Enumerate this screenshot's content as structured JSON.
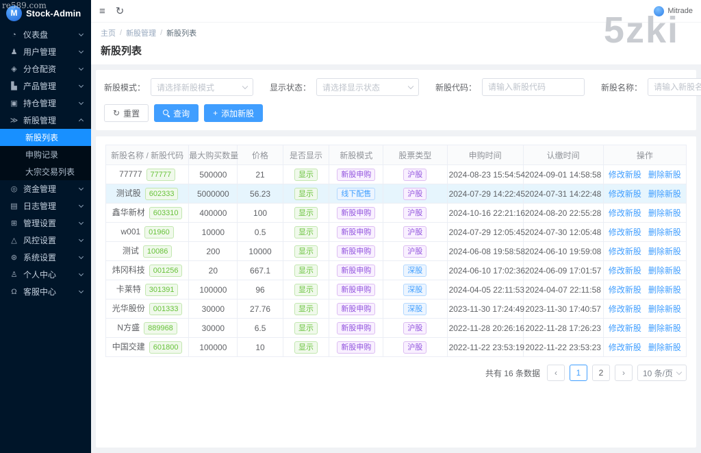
{
  "watermarks": {
    "top_left": "re589.com",
    "top_right": "5zki"
  },
  "sidebar": {
    "logo_text": "Stock-Admin",
    "logo_glyph": "M",
    "items": [
      {
        "key": "dashboard",
        "icon": "gauge-icon",
        "label": "仪表盘"
      },
      {
        "key": "users",
        "icon": "users-icon",
        "label": "用户管理"
      },
      {
        "key": "allocation",
        "icon": "allocation-icon",
        "label": "分仓配资"
      },
      {
        "key": "product",
        "icon": "product-icon",
        "label": "产品管理"
      },
      {
        "key": "holdings",
        "icon": "holdings-icon",
        "label": "持仓管理"
      },
      {
        "key": "new-stock",
        "icon": "new-stock-icon",
        "label": "新股管理",
        "expanded": true,
        "children": [
          {
            "key": "new-stock-list",
            "label": "新股列表",
            "active": true
          },
          {
            "key": "subscription-records",
            "label": "申购记录"
          },
          {
            "key": "block-trade-list",
            "label": "大宗交易列表"
          }
        ]
      },
      {
        "key": "funds",
        "icon": "funds-icon",
        "label": "资金管理"
      },
      {
        "key": "logs",
        "icon": "logs-icon",
        "label": "日志管理"
      },
      {
        "key": "admin-settings",
        "icon": "admin-settings-icon",
        "label": "管理设置"
      },
      {
        "key": "risk-settings",
        "icon": "risk-icon",
        "label": "风控设置"
      },
      {
        "key": "system-settings",
        "icon": "system-icon",
        "label": "系统设置"
      },
      {
        "key": "profile",
        "icon": "profile-icon",
        "label": "个人中心"
      },
      {
        "key": "support",
        "icon": "support-icon",
        "label": "客服中心"
      }
    ]
  },
  "topbar": {
    "user": "Mitrade"
  },
  "breadcrumb": [
    "主页",
    "新股管理",
    "新股列表"
  ],
  "page_title": "新股列表",
  "filters": {
    "mode_label": "新股模式：",
    "mode_placeholder": "请选择新股模式",
    "status_label": "显示状态：",
    "status_placeholder": "请选择显示状态",
    "code_label": "新股代码：",
    "code_placeholder": "请输入新股代码",
    "name_label": "新股名称：",
    "name_placeholder": "请输入新股名称",
    "reset_label": "重置",
    "search_label": "查询",
    "add_label": "添加新股"
  },
  "table": {
    "headers": [
      "新股名称 / 新股代码",
      "最大购买数量",
      "价格",
      "是否显示",
      "新股模式",
      "股票类型",
      "申购时间",
      "认缴时间",
      "操作"
    ],
    "actions": {
      "edit": "修改新股",
      "delete": "删除新股"
    },
    "rows": [
      {
        "name": "77777",
        "code": "77777",
        "max": "500000",
        "price": "21",
        "show": "显示",
        "mode": "新股申购",
        "mode_color": "purple",
        "type": "沪股",
        "type_color": "purple",
        "apply_time": "2024-08-23 15:54:54",
        "pay_time": "2024-09-01 14:58:58",
        "highlight": false
      },
      {
        "name": "测试股",
        "code": "602333",
        "max": "5000000",
        "price": "56.23",
        "show": "显示",
        "mode": "线下配售",
        "mode_color": "blue",
        "type": "沪股",
        "type_color": "purple",
        "apply_time": "2024-07-29 14:22:45",
        "pay_time": "2024-07-31 14:22:48",
        "highlight": true
      },
      {
        "name": "鑫华新材",
        "code": "603310",
        "max": "400000",
        "price": "100",
        "show": "显示",
        "mode": "新股申购",
        "mode_color": "purple",
        "type": "沪股",
        "type_color": "purple",
        "apply_time": "2024-10-16 22:21:16",
        "pay_time": "2024-08-20 22:55:28",
        "highlight": false
      },
      {
        "name": "w001",
        "code": "01960",
        "max": "10000",
        "price": "0.5",
        "show": "显示",
        "mode": "新股申购",
        "mode_color": "purple",
        "type": "沪股",
        "type_color": "purple",
        "apply_time": "2024-07-29 12:05:45",
        "pay_time": "2024-07-30 12:05:48",
        "highlight": false
      },
      {
        "name": "测试",
        "code": "10086",
        "max": "200",
        "price": "10000",
        "show": "显示",
        "mode": "新股申购",
        "mode_color": "purple",
        "type": "沪股",
        "type_color": "purple",
        "apply_time": "2024-06-08 19:58:58",
        "pay_time": "2024-06-10 19:59:08",
        "highlight": false
      },
      {
        "name": "炜冈科技",
        "code": "001256",
        "max": "20",
        "price": "667.1",
        "show": "显示",
        "mode": "新股申购",
        "mode_color": "purple",
        "type": "深股",
        "type_color": "blue",
        "apply_time": "2024-06-10 17:02:36",
        "pay_time": "2024-06-09 17:01:57",
        "highlight": false
      },
      {
        "name": "卡莱特",
        "code": "301391",
        "max": "100000",
        "price": "96",
        "show": "显示",
        "mode": "新股申购",
        "mode_color": "purple",
        "type": "深股",
        "type_color": "blue",
        "apply_time": "2024-04-05 22:11:53",
        "pay_time": "2024-04-07 22:11:58",
        "highlight": false
      },
      {
        "name": "光华股份",
        "code": "001333",
        "max": "30000",
        "price": "27.76",
        "show": "显示",
        "mode": "新股申购",
        "mode_color": "purple",
        "type": "深股",
        "type_color": "blue",
        "apply_time": "2023-11-30 17:24:49",
        "pay_time": "2023-11-30 17:40:57",
        "highlight": false
      },
      {
        "name": "N方盛",
        "code": "889968",
        "max": "30000",
        "price": "6.5",
        "show": "显示",
        "mode": "新股申购",
        "mode_color": "purple",
        "type": "沪股",
        "type_color": "purple",
        "apply_time": "2022-11-28 20:26:16",
        "pay_time": "2022-11-28 17:26:23",
        "highlight": false
      },
      {
        "name": "中国交建",
        "code": "601800",
        "max": "100000",
        "price": "10",
        "show": "显示",
        "mode": "新股申购",
        "mode_color": "purple",
        "type": "沪股",
        "type_color": "purple",
        "apply_time": "2022-11-22 23:53:19",
        "pay_time": "2022-11-22 23:53:23",
        "highlight": false
      }
    ]
  },
  "pagination": {
    "total_text": "共有 16 条数据",
    "pages": [
      "1",
      "2"
    ],
    "active_page": "1",
    "prev_glyph": "‹",
    "next_glyph": "›",
    "page_size": "10 条/页"
  },
  "colors": {
    "sidebar_bg": "#001529",
    "submenu_bg": "#000c17",
    "active_item": "#1890ff",
    "primary": "#409eff",
    "success": "#67c23a",
    "purple_tag": "#9254de",
    "highlight_row": "#e6f5fd",
    "page_bg": "#f0f2f5"
  }
}
